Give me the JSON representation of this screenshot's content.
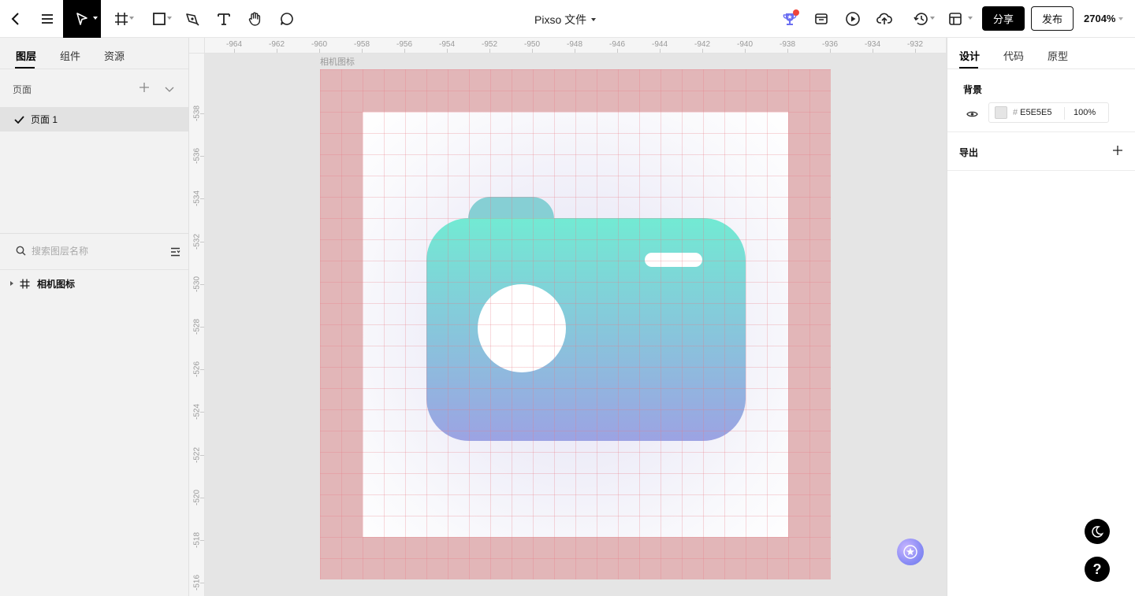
{
  "app": {
    "title": "Pixso 文件",
    "zoom": "2704%"
  },
  "toolbar": {
    "share_label": "分享",
    "publish_label": "发布",
    "icons": [
      "back-icon",
      "menu-icon",
      "move-tool-icon",
      "frame-tool-icon",
      "rectangle-tool-icon",
      "pen-tool-icon",
      "text-tool-icon",
      "hand-tool-icon",
      "comment-icon",
      "trophy-icon",
      "library-icon",
      "play-icon",
      "upload-icon",
      "history-icon",
      "layout-icon"
    ]
  },
  "left_panel": {
    "tabs": [
      {
        "label": "图层",
        "active": true
      },
      {
        "label": "组件",
        "active": false
      },
      {
        "label": "资源",
        "active": false
      }
    ],
    "pages_header": "页面",
    "pages": [
      {
        "label": "页面 1",
        "selected": true
      }
    ],
    "search": {
      "placeholder": "搜索图层名称",
      "value": ""
    },
    "layers": [
      {
        "label": "相机图标",
        "type": "frame"
      }
    ]
  },
  "canvas": {
    "frame_label": "相机图标",
    "ruler_top": [
      "-964",
      "-962",
      "-960",
      "-958",
      "-956",
      "-954",
      "-952",
      "-950",
      "-948",
      "-946",
      "-944",
      "-942",
      "-940",
      "-938",
      "-936",
      "-934",
      "-932"
    ],
    "ruler_left": [
      "-538",
      "-536",
      "-534",
      "-532",
      "-530",
      "-528",
      "-526",
      "-524",
      "-522",
      "-520",
      "-518",
      "-516"
    ],
    "colors": {
      "frame_bg": "#E2B6B8",
      "camera_gradient_top": "#72EAD3",
      "camera_gradient_bottom": "#9CA3E3",
      "camera_tab": "#86CFD4"
    }
  },
  "right_panel": {
    "tabs": [
      {
        "label": "设计",
        "active": true
      },
      {
        "label": "代码",
        "active": false
      },
      {
        "label": "原型",
        "active": false
      }
    ],
    "background": {
      "title": "背景",
      "hash": "#",
      "hex": "E5E5E5",
      "opacity": "100%"
    },
    "export_title": "导出"
  }
}
